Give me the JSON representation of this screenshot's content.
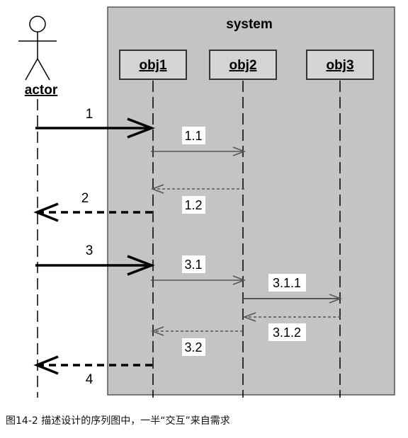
{
  "diagram": {
    "actor_label": "actor",
    "system_label": "system",
    "objects": [
      {
        "id": "obj1",
        "label": "obj1"
      },
      {
        "id": "obj2",
        "label": "obj2"
      },
      {
        "id": "obj3",
        "label": "obj3"
      }
    ],
    "messages": [
      {
        "label": "1",
        "from": "actor",
        "to": "obj1",
        "kind": "call-bold"
      },
      {
        "label": "1.1",
        "from": "obj1",
        "to": "obj2",
        "kind": "call"
      },
      {
        "label": "1.2",
        "from": "obj2",
        "to": "obj1",
        "kind": "return"
      },
      {
        "label": "2",
        "from": "obj1",
        "to": "actor",
        "kind": "return-bold"
      },
      {
        "label": "3",
        "from": "actor",
        "to": "obj1",
        "kind": "call-bold"
      },
      {
        "label": "3.1",
        "from": "obj1",
        "to": "obj2",
        "kind": "call"
      },
      {
        "label": "3.1.1",
        "from": "obj2",
        "to": "obj3",
        "kind": "call"
      },
      {
        "label": "3.1.2",
        "from": "obj3",
        "to": "obj2",
        "kind": "return"
      },
      {
        "label": "3.2",
        "from": "obj2",
        "to": "obj1",
        "kind": "return"
      },
      {
        "label": "4",
        "from": "obj1",
        "to": "actor",
        "kind": "return-bold"
      }
    ],
    "colors": {
      "system_fill": "#c4c4c4",
      "box_fill": "#d4d4d4",
      "line": "#000000"
    }
  },
  "caption": "图14-2 描述设计的序列图中，一半“交互”来自需求"
}
